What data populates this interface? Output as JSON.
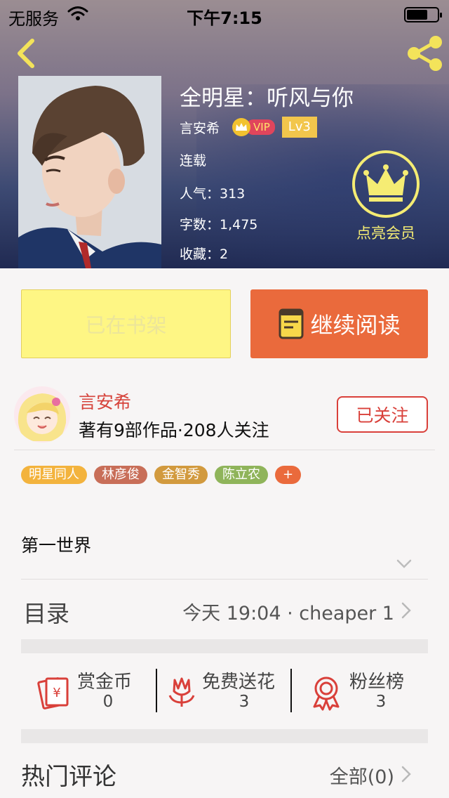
{
  "status_bar": {
    "carrier": "无服务",
    "time": "下午7:15",
    "battery_level": 0.7
  },
  "book": {
    "title": "全明星：听风与你",
    "author": "言安希",
    "vip_label": "VIP",
    "level": "Lv3",
    "status": "连载",
    "popularity": "人气：313",
    "word_count": "字数：1,475",
    "favorites": "收藏：2"
  },
  "vip_cta": {
    "label": "点亮会员"
  },
  "actions": {
    "shelf_label": "已在书架",
    "read_label": "继续阅读"
  },
  "author_card": {
    "name": "言安希",
    "stats": "著有9部作品·208人关注",
    "follow_label": "已关注"
  },
  "tags": [
    {
      "label": "明星同人",
      "color": "#f3b33d"
    },
    {
      "label": "林彦俊",
      "color": "#c86e58"
    },
    {
      "label": "金智秀",
      "color": "#d29a3e"
    },
    {
      "label": "陈立农",
      "color": "#8fb45a"
    },
    {
      "label": "+",
      "color": "#ea6a3c"
    }
  ],
  "world": {
    "name": "第一世界"
  },
  "toc": {
    "label": "目录",
    "latest": "今天 19:04 · cheaper 1"
  },
  "stats": {
    "reward": {
      "label": "赏金币",
      "value": "0"
    },
    "flowers": {
      "label": "免费送花",
      "value": "3"
    },
    "fans": {
      "label": "粉丝榜",
      "value": "3"
    }
  },
  "comments": {
    "label": "热门评论",
    "all_label": "全部(0)"
  },
  "icons": {
    "back": "chevron-left-icon",
    "share": "share-icon",
    "crown": "crown-icon",
    "book": "book-icon",
    "red_envelope": "red-envelope-icon",
    "flower": "flower-icon",
    "medal": "medal-icon"
  },
  "colors": {
    "accent_yellow": "#f5ec73",
    "read_button": "#ea6a3c",
    "shelf_button": "#fef684",
    "author_red": "#d6433b"
  }
}
